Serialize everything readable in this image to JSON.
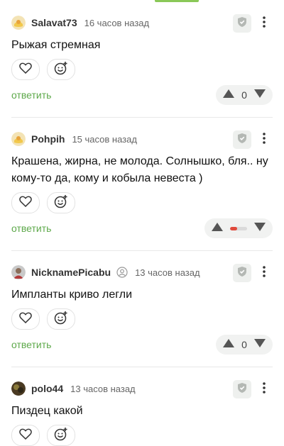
{
  "labels": {
    "reply": "ответить"
  },
  "colors": {
    "accent": "#5ea94b",
    "tab_indicator": "#8ac858",
    "downvote_bar": "#e04a3c"
  },
  "comments": [
    {
      "username": "Salavat73",
      "time": "16 часов назад",
      "text": "Рыжая стремная",
      "rating": "0",
      "avatar": "yellow-avatar"
    },
    {
      "username": "Pohpih",
      "time": "15 часов назад",
      "text": "Крашена, жирна, не молода. Солнышко, бля.. ну кому-то да, кому и кобыла невеста )",
      "rating_bar_fraction": 0.4,
      "avatar": "yellow-avatar"
    },
    {
      "username": "NicknamePicabu",
      "time": "13 часов назад",
      "text": "Импланты криво легли",
      "rating": "0",
      "avatar": "photo-avatar",
      "badge_icon": "user-circle-icon"
    },
    {
      "username": "polo44",
      "time": "13 часов назад",
      "text": "Пиздец какой",
      "avatar": "photo-avatar-dark"
    }
  ]
}
